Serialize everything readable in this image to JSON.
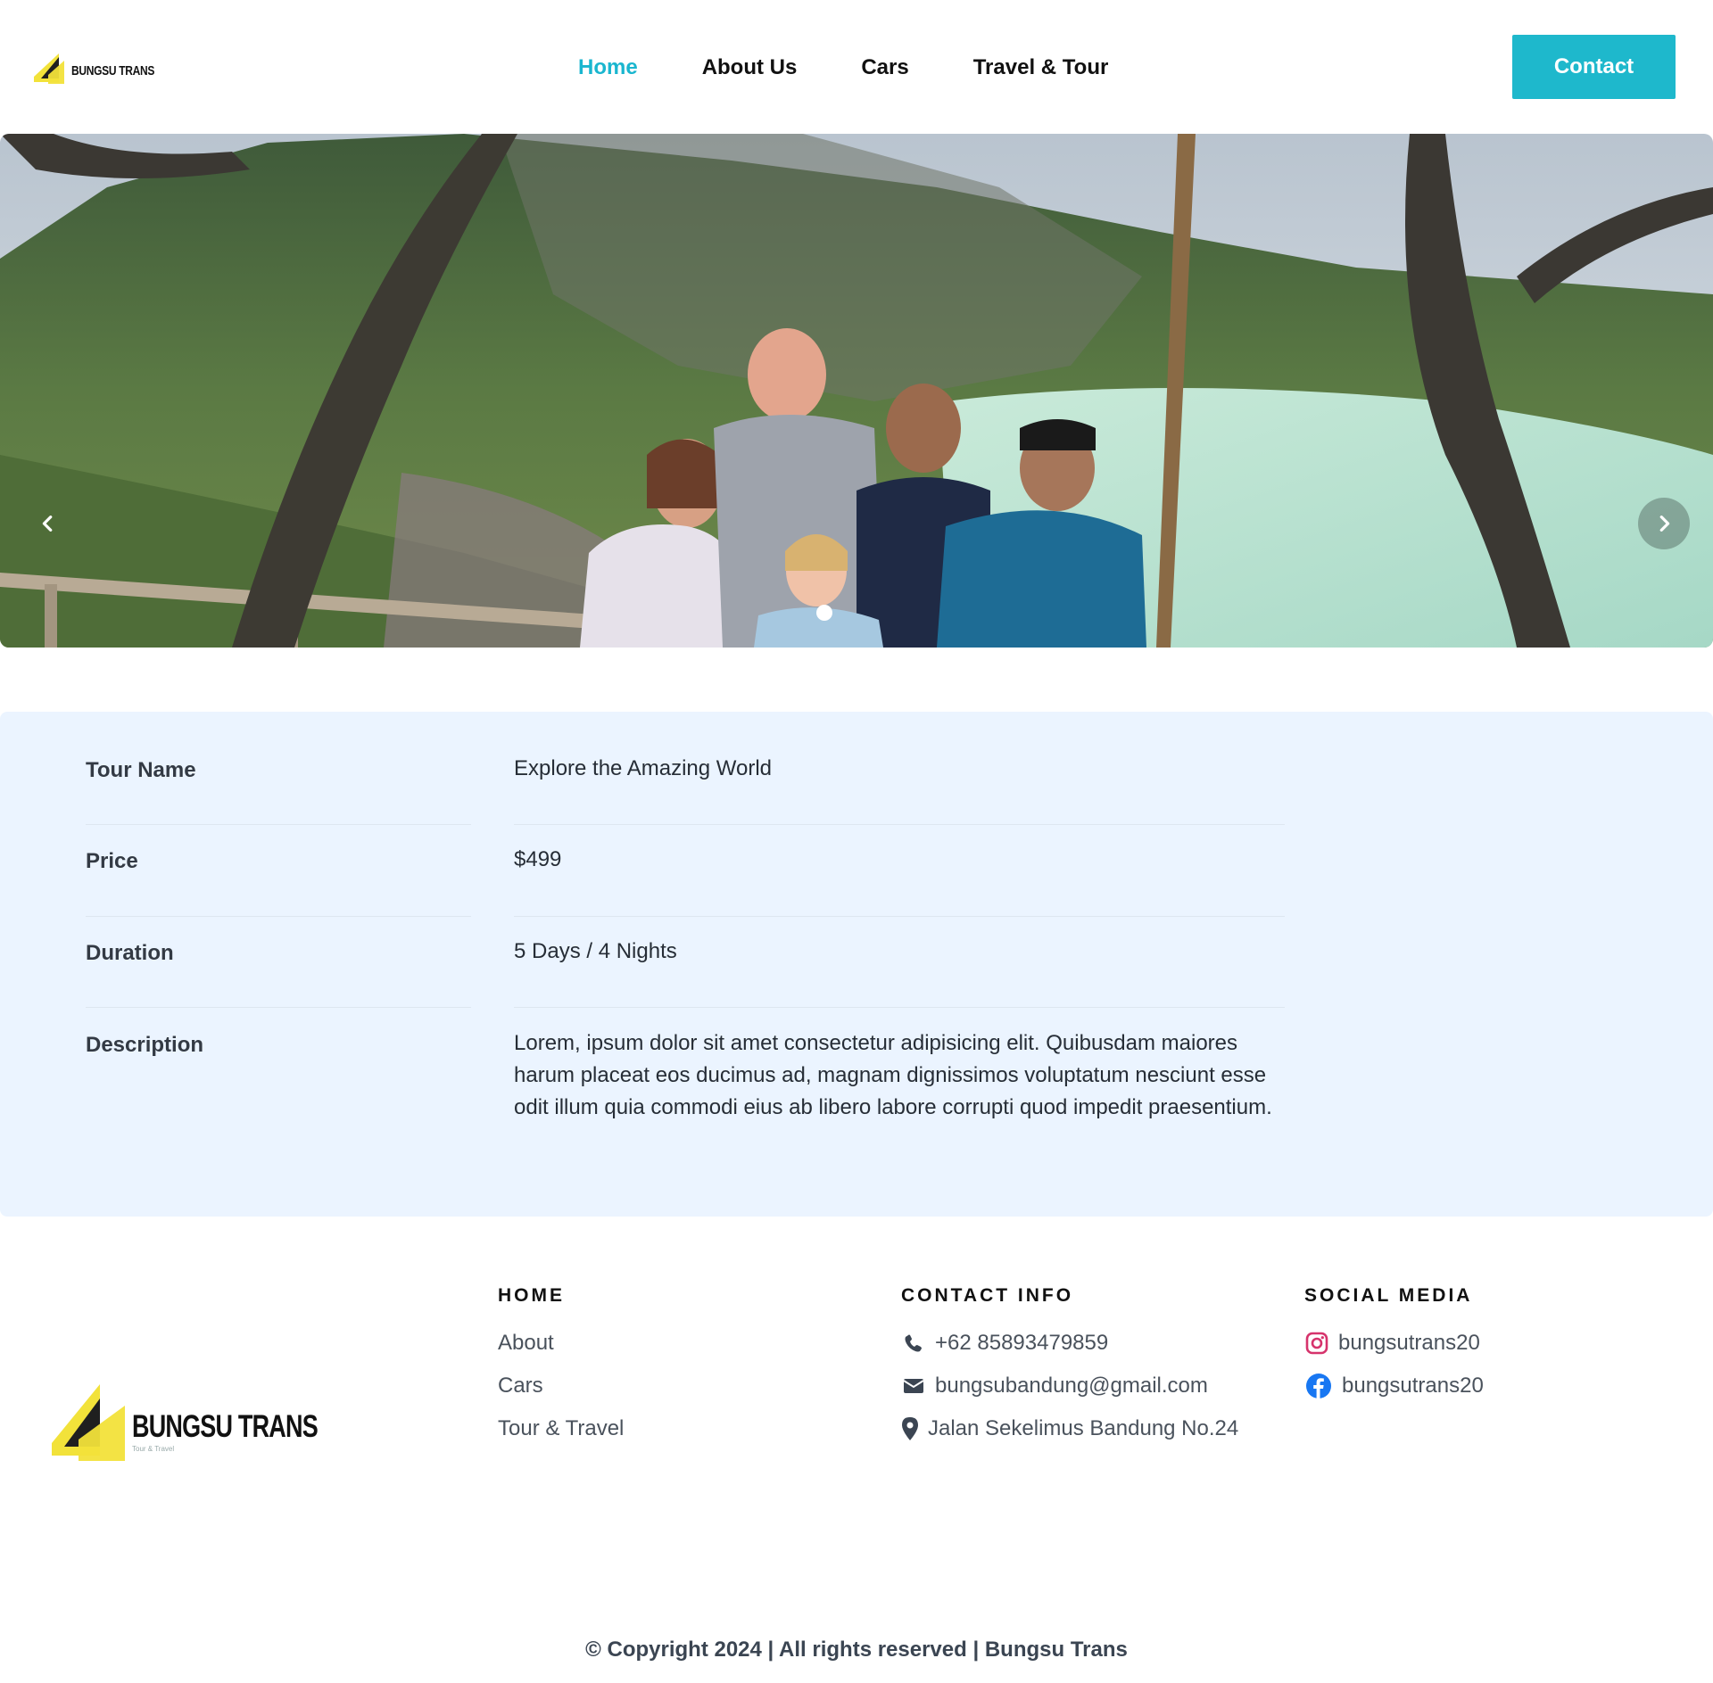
{
  "header": {
    "logo_text": "BUNGSU TRANS",
    "nav": [
      {
        "label": "Home",
        "active": true
      },
      {
        "label": "About Us",
        "active": false
      },
      {
        "label": "Cars",
        "active": false
      },
      {
        "label": "Travel & Tour",
        "active": false
      }
    ],
    "contact_label": "Contact",
    "accent_color": "#1eb8cc"
  },
  "hero": {
    "slide_count": 1,
    "active_slide": 1,
    "prev_icon": "chevron-left-icon",
    "next_icon": "chevron-right-icon"
  },
  "details": {
    "rows": [
      {
        "label": "Tour Name",
        "value": "Explore the Amazing World"
      },
      {
        "label": "Price",
        "value": "$499"
      },
      {
        "label": "Duration",
        "value": "5 Days / 4 Nights"
      },
      {
        "label": "Description",
        "value": "Lorem, ipsum dolor sit amet consectetur adipisicing elit. Quibusdam maiores harum placeat eos ducimus ad, magnam dignissimos voluptatum nesciunt esse odit illum quia commodi eius ab libero labore corrupti quod impedit praesentium."
      }
    ]
  },
  "footer": {
    "logo_text": "BUNGSU TRANS",
    "logo_tagline": "Tour & Travel",
    "home": {
      "heading": "HOME",
      "links": [
        "About",
        "Cars",
        "Tour & Travel"
      ]
    },
    "contact": {
      "heading": "CONTACT INFO",
      "phone": "+62 85893479859",
      "email": "bungsubandung@gmail.com",
      "address": "Jalan Sekelimus Bandung No.24"
    },
    "social": {
      "heading": "SOCIAL MEDIA",
      "instagram": "bungsutrans20",
      "facebook": "bungsutrans20"
    },
    "copyright": "© Copyright 2024 | All rights reserved | Bungsu Trans"
  }
}
